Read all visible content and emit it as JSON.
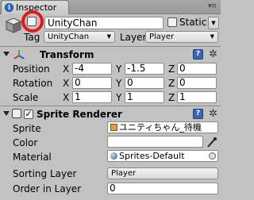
{
  "tab": {
    "title": "Inspector"
  },
  "object": {
    "name": "UnityChan",
    "static_label": "Static",
    "tag_label": "Tag",
    "tag_value": "UnityChan",
    "layer_label": "Layer",
    "layer_value": "Player"
  },
  "transform": {
    "title": "Transform",
    "rows": [
      {
        "label": "Position",
        "x": "-4",
        "y": "-1.5",
        "z": "0"
      },
      {
        "label": "Rotation",
        "x": "0",
        "y": "0",
        "z": "0"
      },
      {
        "label": "Scale",
        "x": "1",
        "y": "1",
        "z": "1"
      }
    ],
    "axes": {
      "x": "X",
      "y": "Y",
      "z": "Z"
    }
  },
  "sprite_renderer": {
    "title": "Sprite Renderer",
    "sprite_label": "Sprite",
    "sprite_value": "ユニティちゃん_待機",
    "color_label": "Color",
    "material_label": "Material",
    "material_value": "Sprites-Default",
    "sorting_layer_label": "Sorting Layer",
    "sorting_layer_value": "Player",
    "order_label": "Order in Layer",
    "order_value": "0"
  },
  "colors": {
    "highlight_ring": "#e3181d",
    "panel_bg": "#c2c2c2",
    "help_icon": "#3a66b6"
  }
}
